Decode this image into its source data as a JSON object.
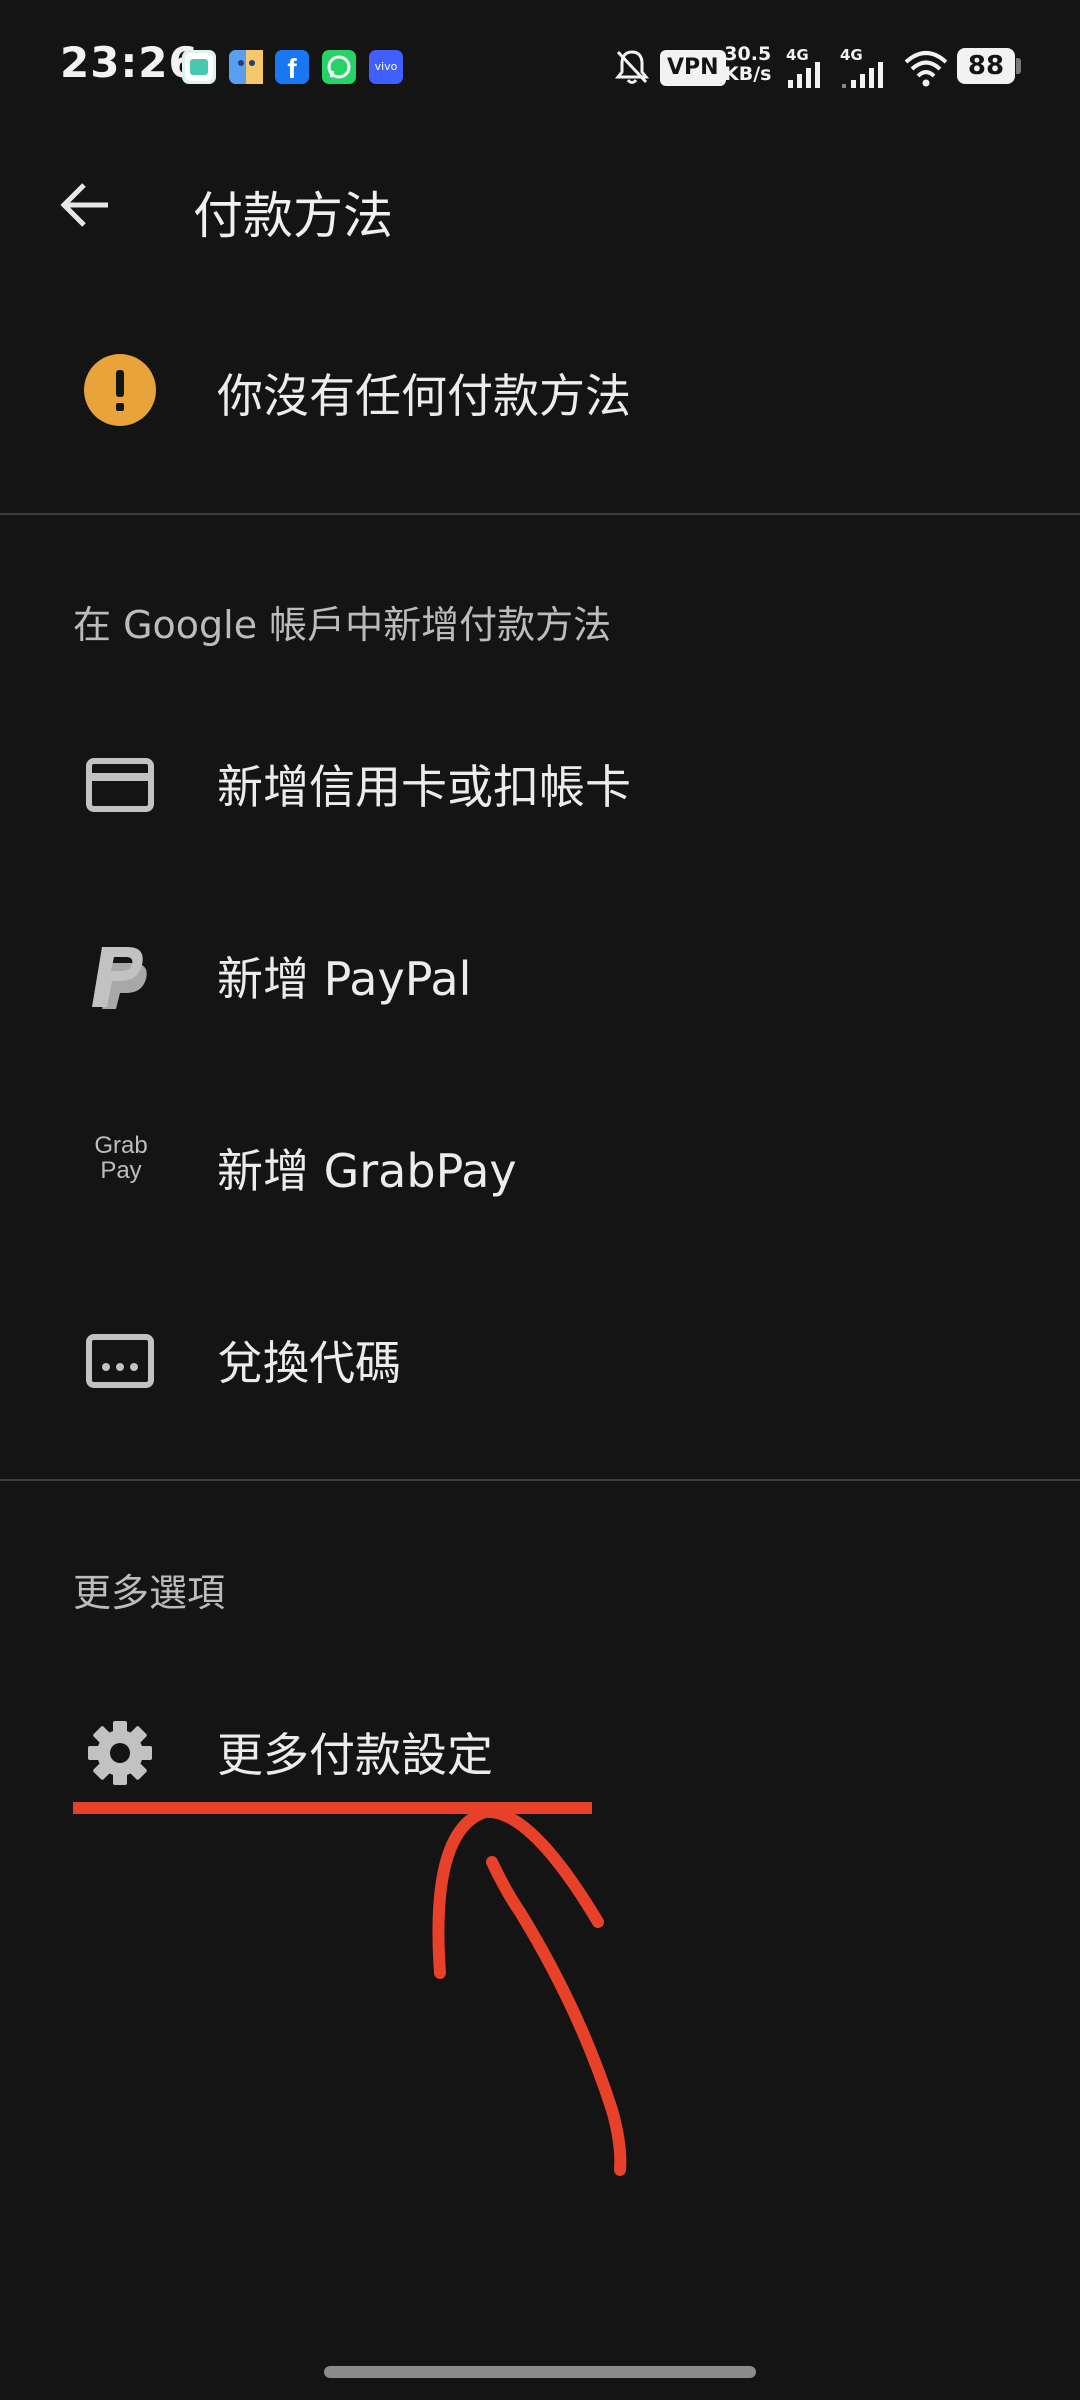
{
  "status_bar": {
    "time": "23:26",
    "vpn": "VPN",
    "speed_value": "30.5",
    "speed_unit": "KB/s",
    "net_1": "4G",
    "net_2": "4G",
    "battery": "88",
    "notification_icons": [
      "gallery-icon",
      "finder-icon",
      "facebook-icon",
      "whatsapp-icon",
      "vivo-icon"
    ]
  },
  "app_bar": {
    "title": "付款方法"
  },
  "warning": {
    "label": "你沒有任何付款方法",
    "color": "#e8a33a"
  },
  "add_section": {
    "header": "在 Google 帳戶中新增付款方法",
    "items": [
      {
        "label": "新增信用卡或扣帳卡",
        "icon": "credit-card-icon"
      },
      {
        "label": "新增 PayPal",
        "icon": "paypal-icon"
      },
      {
        "label": "新增 GrabPay",
        "icon": "grabpay-icon",
        "icon_text_1": "Grab",
        "icon_text_2": "Pay"
      },
      {
        "label": "兌換代碼",
        "icon": "redeem-code-icon"
      }
    ]
  },
  "more_section": {
    "header": "更多選項",
    "items": [
      {
        "label": "更多付款設定",
        "icon": "gear-icon"
      }
    ]
  },
  "annotation_color": "#e8412a"
}
